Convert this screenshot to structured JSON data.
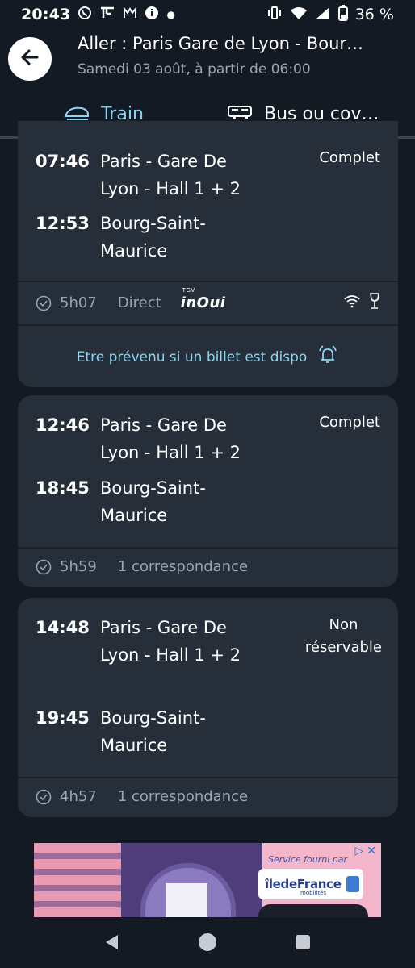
{
  "status_bar": {
    "time": "20:43",
    "battery": "36 %"
  },
  "header": {
    "title": "Aller : Paris Gare de Lyon - Bour…",
    "subtitle": "Samedi 03 août, à partir de 06:00"
  },
  "tabs": [
    {
      "label": "Train",
      "icon": "train-icon",
      "active": true
    },
    {
      "label": "Bus ou cov…",
      "icon": "bus-icon",
      "active": false
    }
  ],
  "journeys": [
    {
      "dep_time": "07:46",
      "dep_station": "Paris - Gare De Lyon - Hall 1 + 2",
      "arr_time": "12:53",
      "arr_station": "Bourg-Saint-Maurice",
      "status": "Complet",
      "duration": "5h07",
      "type": "Direct",
      "operator": "inOui",
      "operator_tag": "TGV",
      "amenities": [
        "wifi-icon",
        "wine-glass-icon"
      ],
      "alert_label": "Etre prévenu si un billet est dispo"
    },
    {
      "dep_time": "12:46",
      "dep_station": "Paris - Gare De Lyon - Hall 1 + 2",
      "arr_time": "18:45",
      "arr_station": "Bourg-Saint-Maurice",
      "status": "Complet",
      "duration": "5h59",
      "type": "1 correspondance"
    },
    {
      "dep_time": "14:48",
      "dep_station": "Paris - Gare De Lyon - Hall 1 + 2",
      "arr_time": "19:45",
      "arr_station": "Bourg-Saint-Maurice",
      "status_line1": "Non",
      "status_line2": "réservable",
      "duration": "4h57",
      "type": "1 correspondance"
    }
  ],
  "ad": {
    "service_text": "Service fourni par",
    "brand": "îledeFrance",
    "brand_sub": "mobilités"
  },
  "colors": {
    "background": "#131a24",
    "card": "#252e39",
    "accent": "#8ad4f2",
    "muted": "#9aa3b0"
  }
}
